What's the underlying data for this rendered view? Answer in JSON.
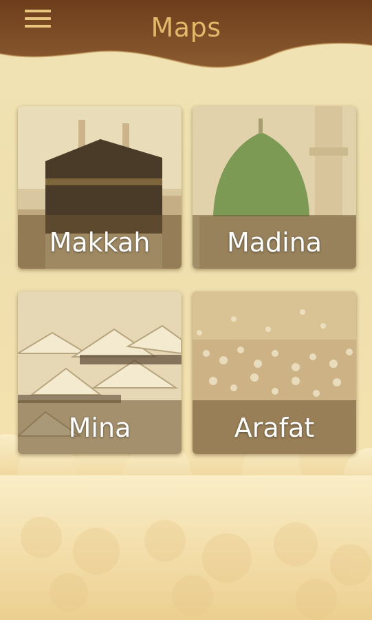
{
  "header": {
    "title": "Maps",
    "menu_icon": "hamburger-menu-icon"
  },
  "tiles": [
    {
      "label": "Makkah",
      "image": "kaaba-image"
    },
    {
      "label": "Madina",
      "image": "green-dome-image"
    },
    {
      "label": "Mina",
      "image": "tent-city-image"
    },
    {
      "label": "Arafat",
      "image": "pilgrims-crowd-image"
    }
  ],
  "colors": {
    "header_brown": "#7a4a24",
    "title_gold": "#e2b86a",
    "background_cream": "#f1e3b4"
  }
}
